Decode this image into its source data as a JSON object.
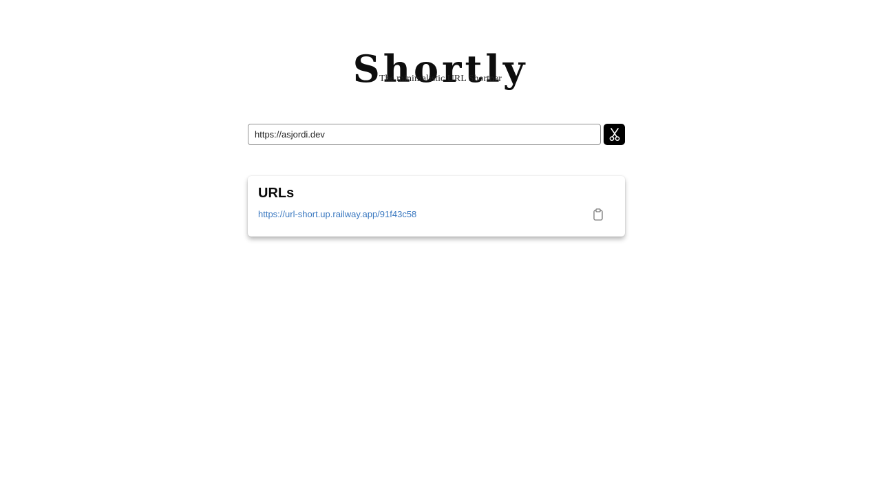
{
  "header": {
    "title": "Shortly",
    "subtitle": "The minimalistic URL Shortner"
  },
  "form": {
    "url_value": "https://asjordi.dev",
    "shorten_icon": "scissors-icon",
    "button_color": "#000000"
  },
  "urls": {
    "title": "URLs",
    "items": [
      {
        "short_url": "https://url-short.up.railway.app/91f43c58",
        "copy_icon": "clipboard-icon"
      }
    ]
  },
  "colors": {
    "link": "#3a78c0",
    "background": "#ffffff",
    "text": "#111111"
  }
}
